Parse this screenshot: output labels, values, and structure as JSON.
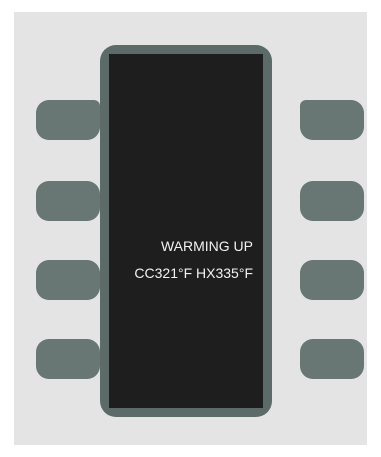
{
  "device": {
    "display": {
      "status": "WARMING UP",
      "temperatures": "CC321°F  HX335°F"
    },
    "buttons": {
      "left": [
        "left-button-1",
        "left-button-2",
        "left-button-3",
        "left-button-4"
      ],
      "right": [
        "right-button-1",
        "right-button-2",
        "right-button-3",
        "right-button-4"
      ]
    }
  },
  "colors": {
    "panel_background": "#e4e4e4",
    "device_bezel": "#5c6b68",
    "screen": "#1e1e1e",
    "button": "#687674",
    "screen_text": "#f2f2f2"
  }
}
